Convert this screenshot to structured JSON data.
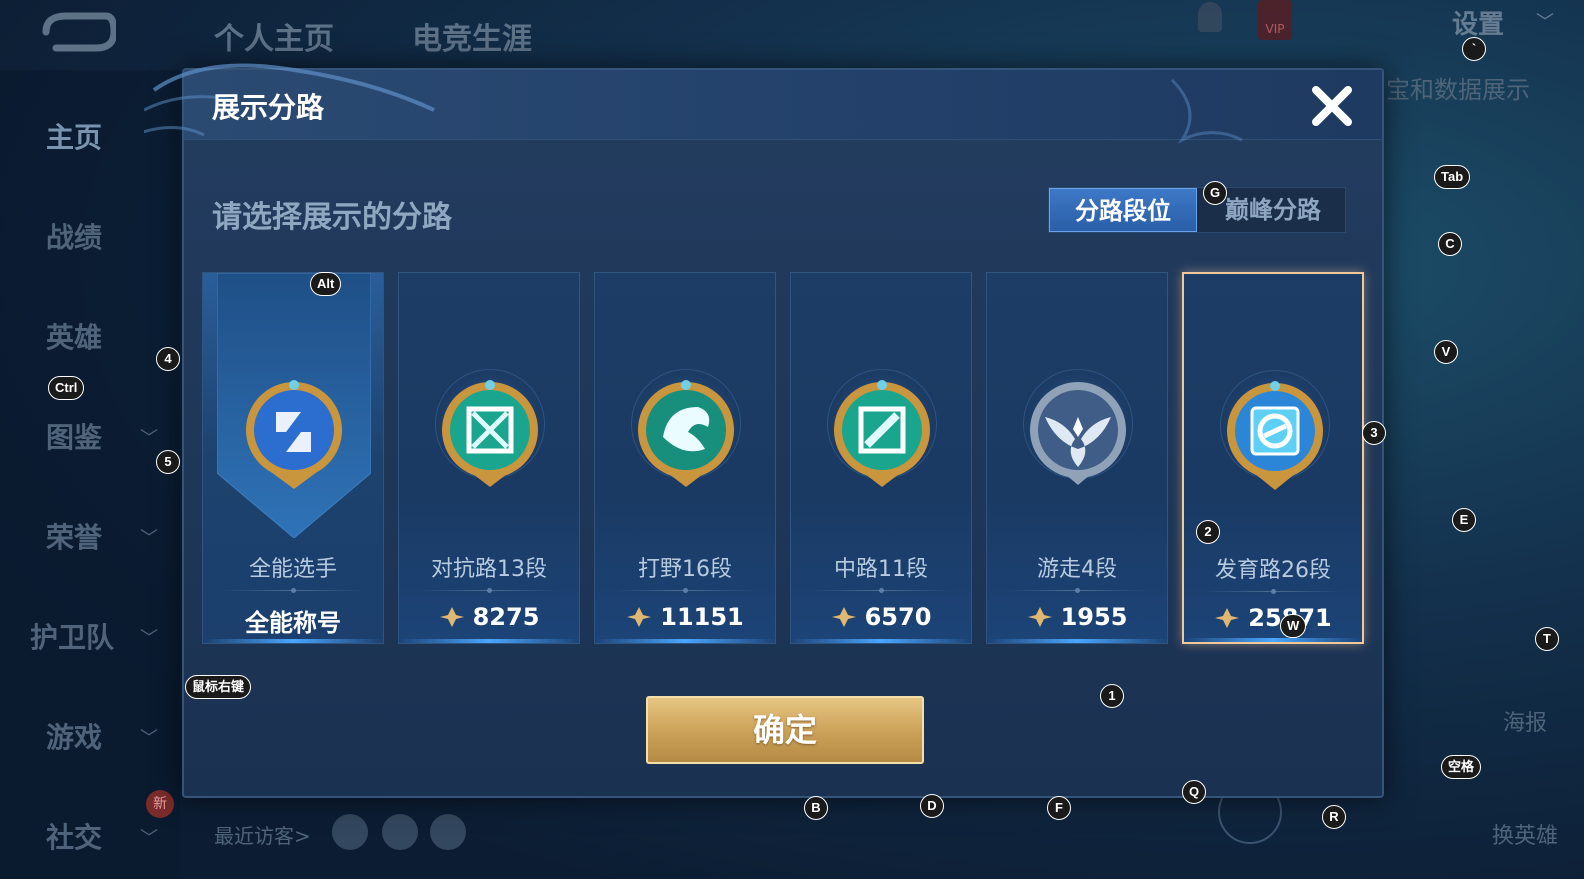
{
  "background": {
    "top_tabs": [
      "个人主页",
      "电竞生涯"
    ],
    "sidebar": [
      {
        "label": "主页",
        "active": true,
        "chevron": false
      },
      {
        "label": "战绩",
        "chevron": false
      },
      {
        "label": "英雄",
        "chevron": false
      },
      {
        "label": "图鉴",
        "chevron": true
      },
      {
        "label": "荣誉",
        "chevron": true
      },
      {
        "label": "护卫队",
        "chevron": true
      },
      {
        "label": "游戏",
        "chevron": true
      },
      {
        "label": "社交",
        "chevron": true
      }
    ],
    "new_badge": "新",
    "recent_visitors": "最近访客>",
    "settings": "设置",
    "vip": "VIP",
    "right_text": "宝和数据展示",
    "poster": "海报",
    "swap_hero": "换英雄"
  },
  "modal": {
    "title": "展示分路",
    "subtitle": "请选择展示的分路",
    "tabs": {
      "active": "分路段位",
      "inactive": "巅峰分路"
    },
    "cards": [
      {
        "label": "全能选手",
        "points": "全能称号",
        "show_icon": false,
        "emblem": "all-round-icon",
        "selected": false
      },
      {
        "label": "对抗路13段",
        "points": "8275",
        "show_icon": true,
        "emblem": "clash-lane-icon",
        "selected": false
      },
      {
        "label": "打野16段",
        "points": "11151",
        "show_icon": true,
        "emblem": "jungle-dragon-icon",
        "selected": false
      },
      {
        "label": "中路11段",
        "points": "6570",
        "show_icon": true,
        "emblem": "mid-lane-icon",
        "selected": false
      },
      {
        "label": "游走4段",
        "points": "1955",
        "show_icon": true,
        "emblem": "roam-wings-icon",
        "selected": false
      },
      {
        "label": "发育路26段",
        "points": "25871",
        "show_icon": true,
        "emblem": "farm-lane-icon",
        "selected": true
      }
    ],
    "confirm": "确定"
  },
  "key_hints": [
    "`",
    "Tab",
    "C",
    "V",
    "3",
    "E",
    "T",
    "空格",
    "R",
    "Q",
    "F",
    "D",
    "B",
    "1",
    "W",
    "2",
    "Alt",
    "4",
    "Ctrl",
    "5",
    "鼠标右键",
    "G"
  ],
  "colors": {
    "selected_border": "#f1c898",
    "confirm_gold": "#cda35a",
    "active_tab": "#3e78c6"
  }
}
